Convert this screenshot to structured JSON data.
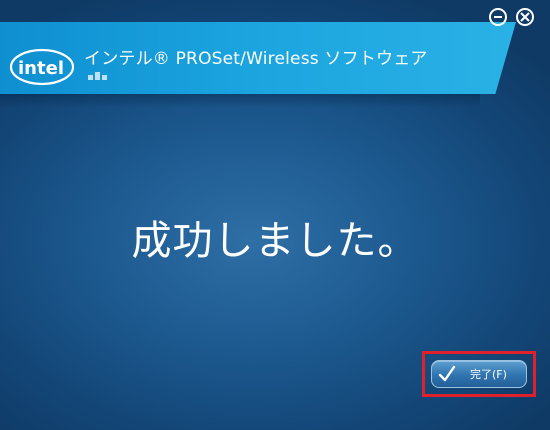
{
  "window": {
    "app_title": "インテル® PROSet/Wireless ソフトウェア",
    "minimize_icon": "minimize-icon",
    "close_icon": "close-icon"
  },
  "logo": {
    "text": "intel"
  },
  "main": {
    "message": "成功しました。"
  },
  "footer": {
    "done_label": "完了(F)",
    "done_icon": "checkmark-icon",
    "highlight_color": "#e0202a"
  },
  "colors": {
    "background": "#1d5a90",
    "header": "#1aa3de",
    "text": "#ffffff"
  }
}
